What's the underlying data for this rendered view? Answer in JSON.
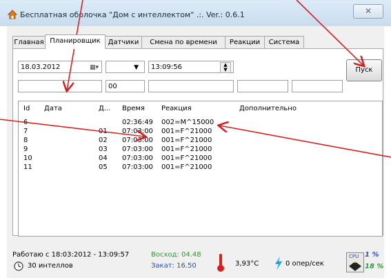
{
  "window": {
    "title": "Бесплатная оболочка \"Дом с интеллектом\" .:. Ver.: 0.6.1",
    "close_label": "✕"
  },
  "tabs": [
    "Главная",
    "Планировщик",
    "Датчики",
    "Смена по времени",
    "Реакции",
    "Система"
  ],
  "active_tab": 1,
  "form": {
    "date": "18.03.2012",
    "time": "13:09:56",
    "number": "00",
    "start_label": "Пуск"
  },
  "table": {
    "columns": [
      "Id",
      "Дата",
      "Д...",
      "Время",
      "Реакция",
      "Дополнительно"
    ],
    "rows": [
      {
        "id": "6",
        "date": "",
        "day": "",
        "time": "02:36:49",
        "reaction": "002=M^15000",
        "extra": ""
      },
      {
        "id": "7",
        "date": "",
        "day": "01",
        "time": "07:03:00",
        "reaction": "001=F^21000",
        "extra": ""
      },
      {
        "id": "8",
        "date": "",
        "day": "02",
        "time": "07:03:00",
        "reaction": "001=F^21000",
        "extra": ""
      },
      {
        "id": "9",
        "date": "",
        "day": "03",
        "time": "07:03:00",
        "reaction": "001=F^21000",
        "extra": ""
      },
      {
        "id": "10",
        "date": "",
        "day": "04",
        "time": "07:03:00",
        "reaction": "001=F^21000",
        "extra": ""
      },
      {
        "id": "11",
        "date": "",
        "day": "05",
        "time": "07:03:00",
        "reaction": "001=F^21000",
        "extra": ""
      }
    ]
  },
  "status": {
    "working_since": "Работаю с 18:03:2012 - 13:09:57",
    "interval": "30 интеллов",
    "sunrise": "Восход: 04.48",
    "sunset": "Закат: 16.50",
    "temperature": "3,93°C",
    "ops": "0 опер/сек",
    "cpu_label": "CPU",
    "cpu_percent": "1 %",
    "ram_percent": "18 %"
  },
  "colors": {
    "sunrise": "#2f9a2f",
    "sunset": "#2a4fc8",
    "annotation": "#d42020",
    "cpu_percent": "#2a4fc8",
    "ram_percent": "#2f9a2f"
  }
}
